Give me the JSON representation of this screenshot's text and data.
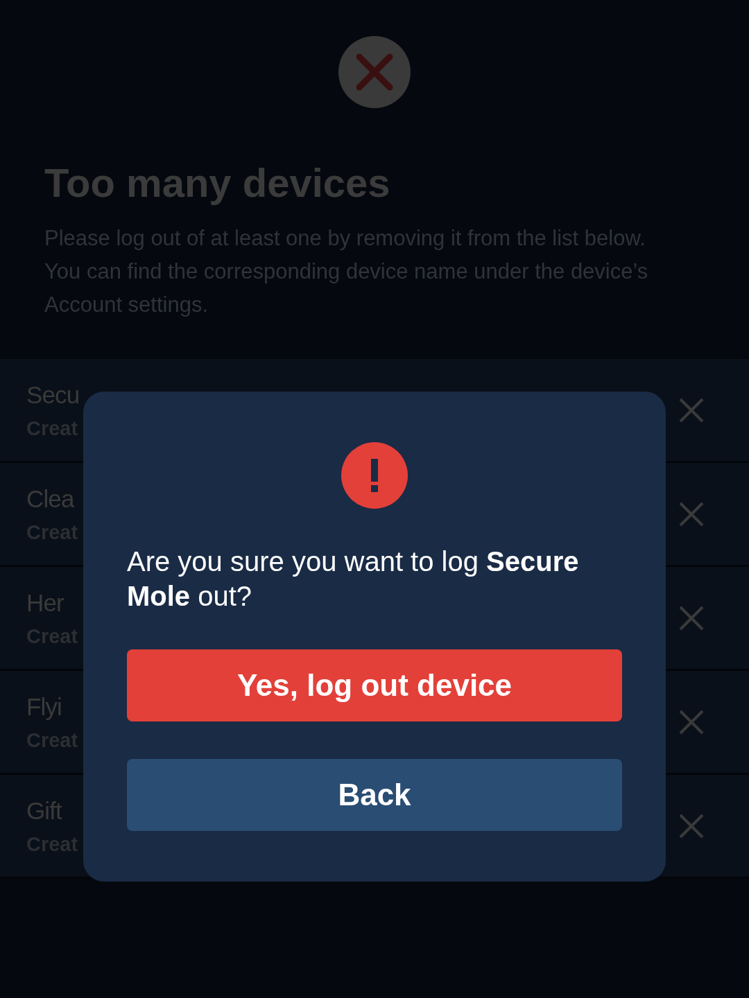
{
  "header": {
    "title": "Too many devices",
    "description": "Please log out of at least one by removing it from the list below. You can find the corresponding device name under the device’s Account settings."
  },
  "devices": [
    {
      "name": "Secu",
      "subtitle": "Creat"
    },
    {
      "name": "Clea",
      "subtitle": "Creat"
    },
    {
      "name": "Her",
      "subtitle": "Creat"
    },
    {
      "name": "Flyi",
      "subtitle": "Creat"
    },
    {
      "name": "Gift",
      "subtitle": "Creat"
    }
  ],
  "dialog": {
    "message": "Are you sure you want to log **Secure Mole** out?",
    "buttons": [
      {
        "label": "Yes, log out device",
        "kind": "danger"
      },
      {
        "label": "Back",
        "kind": "secondary"
      }
    ]
  }
}
